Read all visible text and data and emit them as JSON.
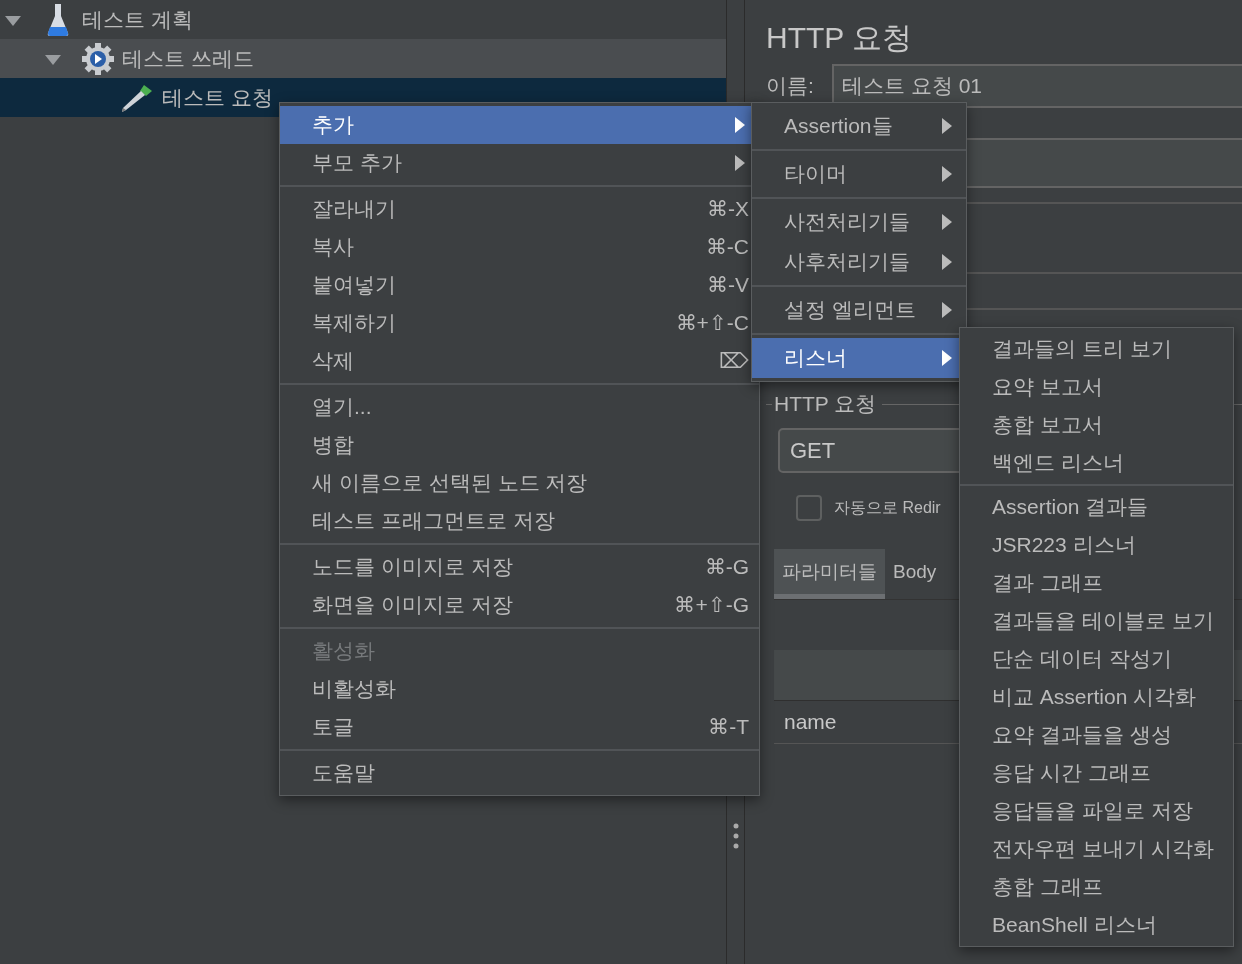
{
  "tree": {
    "items": [
      {
        "label": "테스트 계획",
        "kind": "plan",
        "expanded": true,
        "selected": false,
        "hovered": false,
        "children": [
          {
            "label": "테스트 쓰레드",
            "kind": "thread",
            "expanded": true,
            "selected": false,
            "hovered": true,
            "children": [
              {
                "label": "테스트 요청",
                "kind": "sampler",
                "selected": true,
                "hovered": false
              }
            ]
          }
        ]
      }
    ]
  },
  "editor": {
    "title": "HTTP 요청",
    "name_label": "이름:",
    "name_value": "테스트 요청 01",
    "section_title": "HTTP 요청",
    "method": "GET",
    "redirect_checkbox": {
      "label": "자동으로 Redir",
      "checked": false
    },
    "tabs": [
      {
        "label": "파라미터들",
        "selected": true
      },
      {
        "label": "Body",
        "selected": false
      }
    ],
    "table": {
      "rows": [
        {
          "cell_1": "name"
        }
      ]
    }
  },
  "context_menu": {
    "groups": [
      {
        "items": [
          {
            "label": "추가",
            "submenu": true,
            "selected": true,
            "disabled": false
          },
          {
            "label": "부모 추가",
            "submenu": true,
            "selected": false,
            "disabled": false
          }
        ]
      },
      {
        "items": [
          {
            "label": "잘라내기",
            "shortcut": "⌘-X",
            "submenu": false,
            "selected": false,
            "disabled": false
          },
          {
            "label": "복사",
            "shortcut": "⌘-C",
            "submenu": false,
            "selected": false,
            "disabled": false
          },
          {
            "label": "붙여넣기",
            "shortcut": "⌘-V",
            "submenu": false,
            "selected": false,
            "disabled": false
          },
          {
            "label": "복제하기",
            "shortcut": "⌘+⇧-C",
            "submenu": false,
            "selected": false,
            "disabled": false
          },
          {
            "label": "삭제",
            "shortcut": "⌦",
            "submenu": false,
            "selected": false,
            "disabled": false
          }
        ]
      },
      {
        "items": [
          {
            "label": "열기...",
            "submenu": false,
            "selected": false,
            "disabled": false
          },
          {
            "label": "병합",
            "submenu": false,
            "selected": false,
            "disabled": false
          },
          {
            "label": "새 이름으로 선택된 노드 저장",
            "submenu": false,
            "selected": false,
            "disabled": false
          },
          {
            "label": "테스트 프래그먼트로 저장",
            "submenu": false,
            "selected": false,
            "disabled": false
          }
        ]
      },
      {
        "items": [
          {
            "label": "노드를 이미지로 저장",
            "shortcut": "⌘-G",
            "submenu": false,
            "selected": false,
            "disabled": false
          },
          {
            "label": "화면을 이미지로 저장",
            "shortcut": "⌘+⇧-G",
            "submenu": false,
            "selected": false,
            "disabled": false
          }
        ]
      },
      {
        "items": [
          {
            "label": "활성화",
            "submenu": false,
            "selected": false,
            "disabled": true
          },
          {
            "label": "비활성화",
            "submenu": false,
            "selected": false,
            "disabled": false
          },
          {
            "label": "토글",
            "shortcut": "⌘-T",
            "submenu": false,
            "selected": false,
            "disabled": false
          }
        ]
      },
      {
        "items": [
          {
            "label": "도움말",
            "submenu": false,
            "selected": false,
            "disabled": false
          }
        ]
      }
    ]
  },
  "add_menu": {
    "groups": [
      {
        "items": [
          {
            "label": "Assertion들",
            "submenu": true,
            "selected": false
          }
        ]
      },
      {
        "items": [
          {
            "label": "타이머",
            "submenu": true,
            "selected": false
          }
        ]
      },
      {
        "items": [
          {
            "label": "사전처리기들",
            "submenu": true,
            "selected": false
          },
          {
            "label": "사후처리기들",
            "submenu": true,
            "selected": false
          }
        ]
      },
      {
        "items": [
          {
            "label": "설정 엘리먼트",
            "submenu": true,
            "selected": false
          }
        ]
      },
      {
        "items": [
          {
            "label": "리스너",
            "submenu": true,
            "selected": true
          }
        ]
      }
    ]
  },
  "listener_menu": {
    "groups": [
      {
        "items": [
          {
            "label": "결과들의 트리 보기",
            "submenu": false,
            "selected": false
          },
          {
            "label": "요약 보고서",
            "submenu": false,
            "selected": false
          },
          {
            "label": "총합 보고서",
            "submenu": false,
            "selected": false
          },
          {
            "label": "백엔드 리스너",
            "submenu": false,
            "selected": false
          }
        ]
      },
      {
        "items": [
          {
            "label": "Assertion 결과들",
            "submenu": false,
            "selected": false
          },
          {
            "label": "JSR223 리스너",
            "submenu": false,
            "selected": false
          },
          {
            "label": "결과 그래프",
            "submenu": false,
            "selected": false
          },
          {
            "label": "결과들을 테이블로 보기",
            "submenu": false,
            "selected": false
          },
          {
            "label": "단순 데이터 작성기",
            "submenu": false,
            "selected": false
          },
          {
            "label": "비교 Assertion 시각화",
            "submenu": false,
            "selected": false
          },
          {
            "label": "요약 결과들을 생성",
            "submenu": false,
            "selected": false
          },
          {
            "label": "응답 시간 그래프",
            "submenu": false,
            "selected": false
          },
          {
            "label": "응답들을 파일로 저장",
            "submenu": false,
            "selected": false
          },
          {
            "label": "전자우편 보내기 시각화",
            "submenu": false,
            "selected": false
          },
          {
            "label": "총합 그래프",
            "submenu": false,
            "selected": false
          },
          {
            "label": "BeanShell 리스너",
            "submenu": false,
            "selected": false
          }
        ]
      }
    ]
  }
}
